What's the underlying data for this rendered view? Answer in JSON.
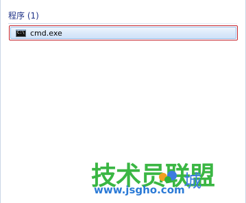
{
  "results": {
    "group_header": "程序 (1)",
    "items": [
      {
        "label": "cmd.exe",
        "icon": "command-prompt-icon",
        "icon_glyph": "C:\\"
      }
    ]
  },
  "watermark": {
    "main": "技术员联盟",
    "city": "城",
    "url": "www.jsgho.com",
    "url_tail": "com"
  },
  "colors": {
    "header_text": "#1e3287",
    "selection_border": "#c3202a",
    "selection_fill": "#dbe9fa",
    "watermark_green": "#30b339",
    "watermark_blue": "#2b7ad6"
  }
}
